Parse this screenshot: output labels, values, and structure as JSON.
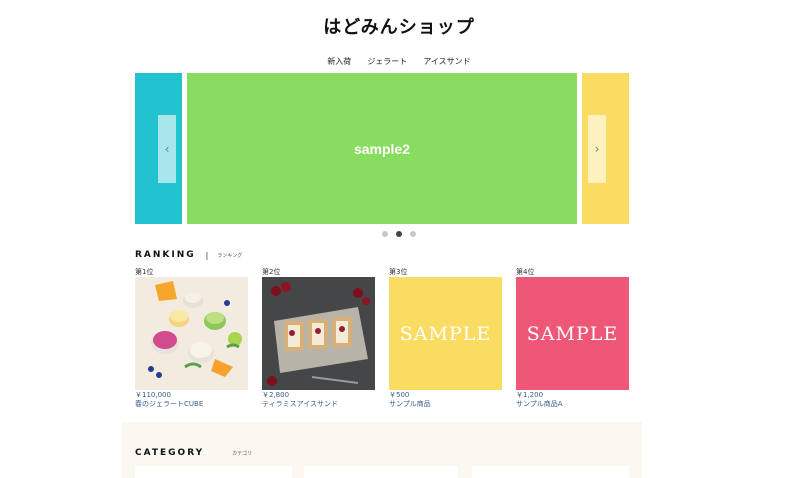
{
  "header": {
    "title": "はどみんショップ"
  },
  "nav": {
    "items": [
      "新入荷",
      "ジェラート",
      "アイスサンド"
    ]
  },
  "slider": {
    "slides": [
      {
        "label": "",
        "color": "#23c2d0"
      },
      {
        "label": "sample2",
        "color": "#88dc5f"
      },
      {
        "label": "",
        "color": "#fbdc62"
      }
    ],
    "prev_icon": "chevron-left-icon",
    "next_icon": "chevron-right-icon",
    "dot_count": 3,
    "active_dot": 1
  },
  "ranking": {
    "heading_en": "RANKING",
    "separator": "|",
    "heading_jp": "ランキング",
    "items": [
      {
        "rank": "第1位",
        "price": "￥110,000",
        "name": "春のジェラートCUBE",
        "image": "gelato-cups-photo"
      },
      {
        "rank": "第2位",
        "price": "￥2,800",
        "name": "ティラミスアイスサンド",
        "image": "ice-sandwich-photo"
      },
      {
        "rank": "第3位",
        "price": "￥500",
        "name": "サンプル商品",
        "image": "sample-yellow",
        "image_text": "SAMPLE",
        "image_color": "#fbdc62"
      },
      {
        "rank": "第4位",
        "price": "￥1,200",
        "name": "サンプル商品A",
        "image": "sample-pink",
        "image_text": "SAMPLE",
        "image_color": "#ef5778"
      }
    ]
  },
  "category": {
    "heading_en": "CATEGORY",
    "heading_jp": "カテゴリ"
  }
}
